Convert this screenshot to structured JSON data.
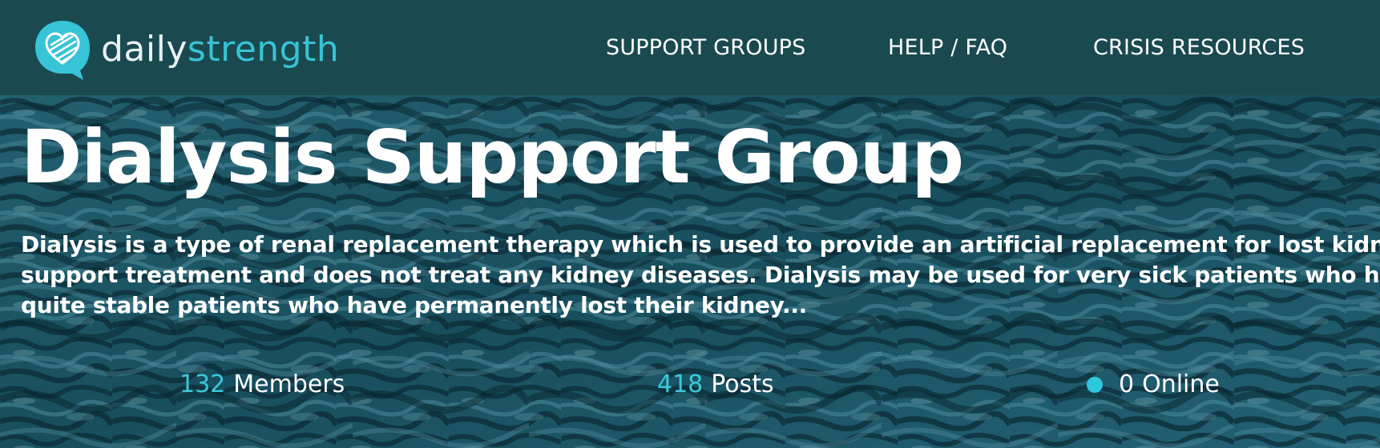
{
  "brand": {
    "name_part1": "daily",
    "name_part2": "strength",
    "logo_icon": "heart-chat-bubble-icon",
    "colors": {
      "header_bg": "#1a4a4f",
      "accent": "#36c4d6",
      "text": "#ffffff"
    }
  },
  "nav": {
    "items": [
      {
        "label": "SUPPORT GROUPS"
      },
      {
        "label": "HELP / FAQ"
      },
      {
        "label": "CRISIS RESOURCES"
      }
    ]
  },
  "hero": {
    "title": "Dialysis Support Group",
    "description_lines": [
      "Dialysis is a type of renal replacement therapy which is used to provide an artificial replacement for lost kidney",
      "support treatment and does not treat any kidney diseases. Dialysis may be used for very sick patients who have",
      "quite stable patients who have permanently lost their kidney..."
    ]
  },
  "stats": {
    "members": {
      "value": "132",
      "label": "Members"
    },
    "posts": {
      "value": "418",
      "label": "Posts"
    },
    "online": {
      "value": "0",
      "label": "Online",
      "indicator_color": "#2ec8dd"
    }
  }
}
